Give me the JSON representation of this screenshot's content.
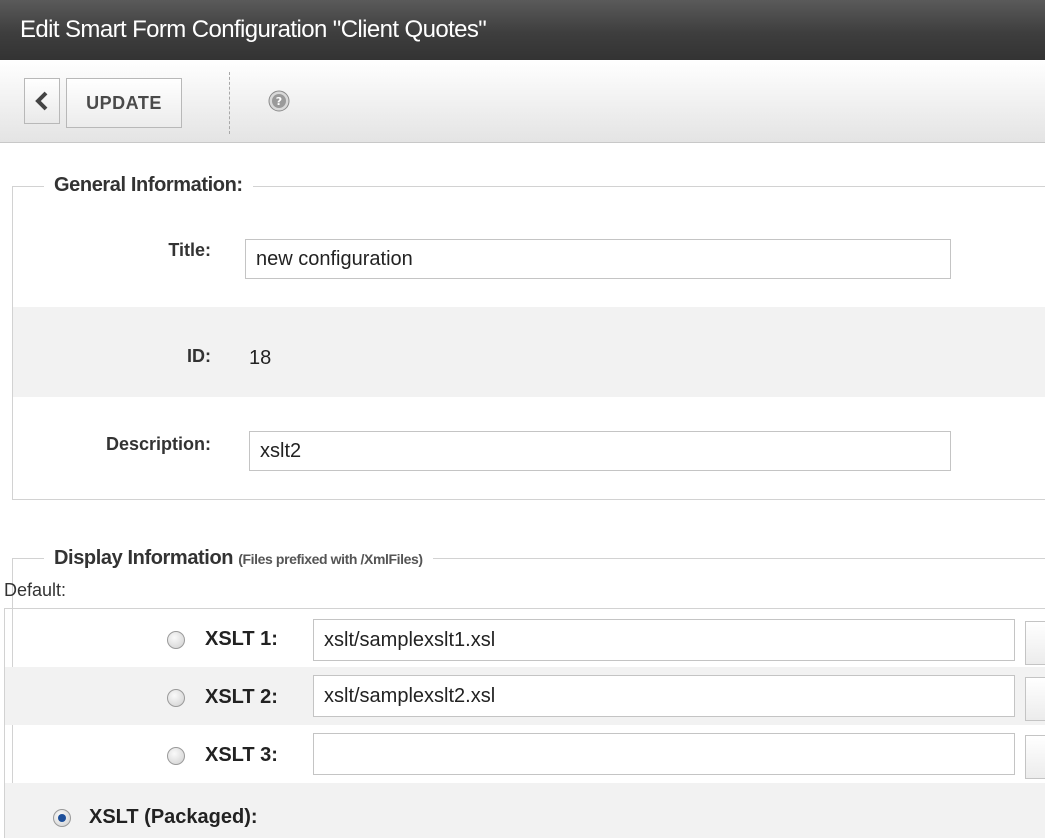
{
  "window": {
    "title": "Edit Smart Form Configuration \"Client Quotes\""
  },
  "toolbar": {
    "update_label": "UPDATE",
    "back_icon": "chevron-left-icon",
    "help_icon": "help-icon"
  },
  "general": {
    "legend": "General Information:",
    "title_label": "Title:",
    "title_value": "new configuration",
    "id_label": "ID:",
    "id_value": "18",
    "description_label": "Description:",
    "description_value": "xslt2"
  },
  "display": {
    "legend": "Display Information",
    "legend_note": "(Files prefixed with /XmlFiles)",
    "default_label": "Default:",
    "xslt": [
      {
        "label": "XSLT 1:",
        "value": "xslt/samplexslt1.xsl",
        "checked": false
      },
      {
        "label": "XSLT 2:",
        "value": "xslt/samplexslt2.xsl",
        "checked": false
      },
      {
        "label": "XSLT 3:",
        "value": "",
        "checked": false
      }
    ],
    "packaged_label": "XSLT (Packaged):",
    "packaged_checked": true
  },
  "colors": {
    "titlebar": "#3e3e3e",
    "radio_selected": "#1d4f9a"
  }
}
